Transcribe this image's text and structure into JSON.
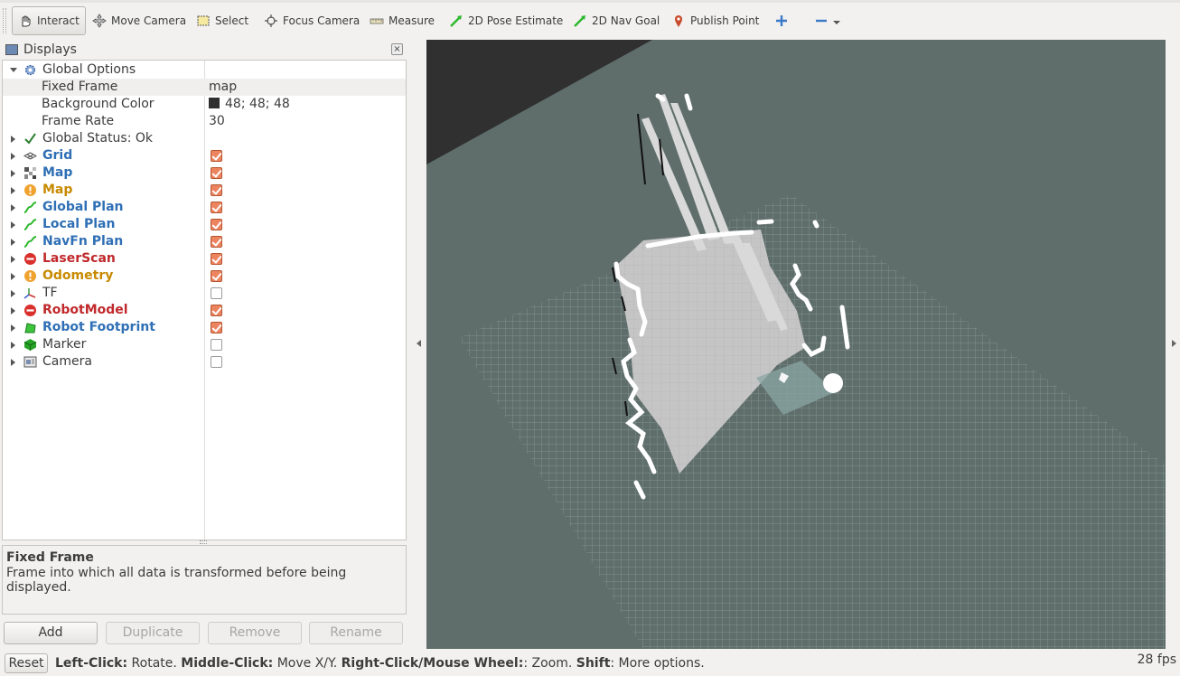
{
  "toolbar": {
    "tools": [
      {
        "label": "Interact",
        "icon": "hand-pointer-icon",
        "active": true
      },
      {
        "label": "Move Camera",
        "icon": "move-arrows-icon"
      },
      {
        "label": "Select",
        "icon": "select-rectangle-icon"
      },
      {
        "label": "Focus Camera",
        "icon": "focus-target-icon"
      },
      {
        "label": "Measure",
        "icon": "ruler-icon"
      },
      {
        "label": "2D Pose Estimate",
        "icon": "green-arrow-icon"
      },
      {
        "label": "2D Nav Goal",
        "icon": "green-arrow-icon"
      },
      {
        "label": "Publish Point",
        "icon": "map-pin-icon"
      }
    ]
  },
  "displays_panel": {
    "title": "Displays",
    "global_options": {
      "label": "Global Options",
      "fixed_frame": {
        "label": "Fixed Frame",
        "value": "map"
      },
      "background_color": {
        "label": "Background Color",
        "value": "48; 48; 48",
        "swatch": "#303030"
      },
      "frame_rate": {
        "label": "Frame Rate",
        "value": "30"
      }
    },
    "global_status": "Global Status: Ok",
    "items": [
      {
        "label": "Grid",
        "checked": true,
        "color": "blue",
        "icon": "grid-icon"
      },
      {
        "label": "Map",
        "checked": true,
        "color": "blue",
        "icon": "map-icon"
      },
      {
        "label": "Map",
        "checked": true,
        "color": "orange",
        "icon": "warning-icon"
      },
      {
        "label": "Global Plan",
        "checked": true,
        "color": "blue",
        "icon": "path-icon"
      },
      {
        "label": "Local Plan",
        "checked": true,
        "color": "blue",
        "icon": "path-icon"
      },
      {
        "label": "NavFn Plan",
        "checked": true,
        "color": "blue",
        "icon": "path-icon"
      },
      {
        "label": "LaserScan",
        "checked": true,
        "color": "red",
        "icon": "error-icon"
      },
      {
        "label": "Odometry",
        "checked": true,
        "color": "orange",
        "icon": "warning-icon"
      },
      {
        "label": "TF",
        "checked": false,
        "color": "normal",
        "icon": "axes-icon"
      },
      {
        "label": "RobotModel",
        "checked": true,
        "color": "red",
        "icon": "error-icon"
      },
      {
        "label": "Robot Footprint",
        "checked": true,
        "color": "blue",
        "icon": "polygon-icon"
      },
      {
        "label": "Marker",
        "checked": false,
        "color": "normal",
        "icon": "cube-icon"
      },
      {
        "label": "Camera",
        "checked": false,
        "color": "normal",
        "icon": "camera-icon"
      }
    ]
  },
  "help": {
    "title": "Fixed Frame",
    "description": "Frame into which all data is transformed before being displayed."
  },
  "buttons": {
    "add": "Add",
    "duplicate": "Duplicate",
    "remove": "Remove",
    "rename": "Rename"
  },
  "statusbar": {
    "reset": "Reset",
    "hint_parts": [
      {
        "b": "Left-Click:",
        "t": " Rotate. "
      },
      {
        "b": "Middle-Click:",
        "t": " Move X/Y. "
      },
      {
        "b": "Right-Click/Mouse Wheel:",
        "t": ": Zoom. "
      },
      {
        "b": "Shift",
        "t": ": More options."
      }
    ],
    "fps": "28 fps"
  },
  "colors": {
    "viewport_bg": "#303030",
    "grid_plane": "#5f6e6b",
    "checkbox_on": "#ec8460"
  }
}
